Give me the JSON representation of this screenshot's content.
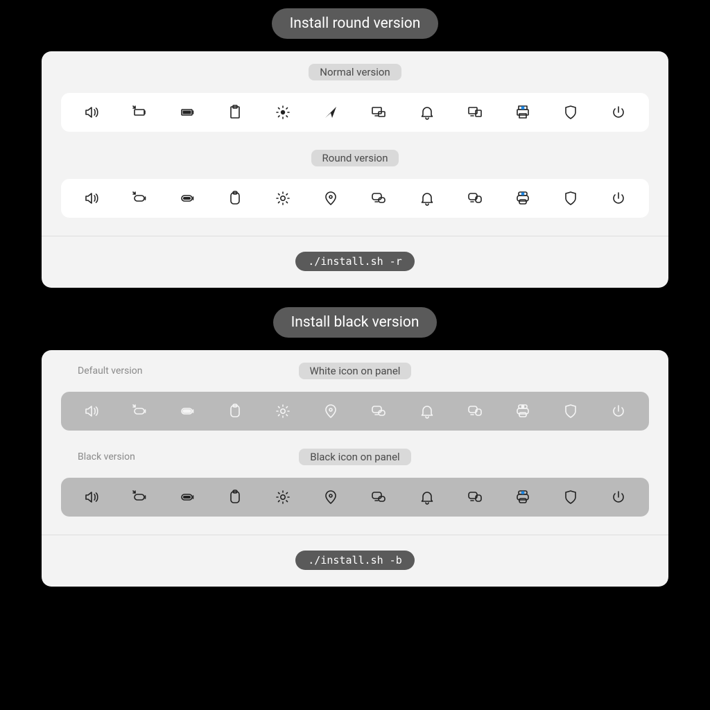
{
  "sections": [
    {
      "title": "Install round version",
      "command": "./install.sh -r",
      "rows": [
        {
          "sublabel": "Normal version",
          "variant": "normal",
          "panel": "white",
          "icon_color": "black"
        },
        {
          "sublabel": "Round version",
          "variant": "round",
          "panel": "white",
          "icon_color": "black"
        }
      ]
    },
    {
      "title": "Install black version",
      "command": "./install.sh -b",
      "rows": [
        {
          "sublabel": "White icon on panel",
          "side_label": "Default version",
          "variant": "round",
          "panel": "gray",
          "icon_color": "white"
        },
        {
          "sublabel": "Black icon on panel",
          "side_label": "Black version",
          "variant": "round",
          "panel": "gray",
          "icon_color": "black"
        }
      ]
    }
  ],
  "icon_names": [
    "volume-icon",
    "battery-charging-icon",
    "battery-full-icon",
    "clipboard-icon",
    "brightness-icon",
    "location-icon",
    "screen-cast-icon",
    "notification-bell-icon",
    "multi-display-icon",
    "printer-icon",
    "privacy-shield-icon",
    "power-icon"
  ]
}
